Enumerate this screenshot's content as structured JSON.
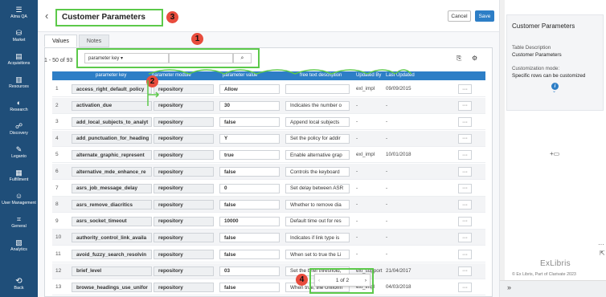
{
  "nav": {
    "items": [
      {
        "label": "Alma QA",
        "icon": "hamburger-icon",
        "glyph": "☰"
      },
      {
        "label": "Market",
        "icon": "market-icon",
        "glyph": "⛁"
      },
      {
        "label": "Acquisitions",
        "icon": "acquisitions-icon",
        "glyph": "▤"
      },
      {
        "label": "Resources",
        "icon": "resources-icon",
        "glyph": "▥"
      },
      {
        "label": "Research",
        "icon": "research-icon",
        "glyph": "◐"
      },
      {
        "label": "Discovery",
        "icon": "discovery-icon",
        "glyph": "☍"
      },
      {
        "label": "Leganto",
        "icon": "leganto-icon",
        "glyph": "✎"
      },
      {
        "label": "Fulfillment",
        "icon": "fulfillment-icon",
        "glyph": "▦"
      },
      {
        "label": "User Management",
        "icon": "user-icon",
        "glyph": "☺"
      },
      {
        "label": "General",
        "icon": "general-icon",
        "glyph": "⌗"
      },
      {
        "label": "Analytics",
        "icon": "analytics-icon",
        "glyph": "▧"
      }
    ],
    "back_label": "Back"
  },
  "header": {
    "title": "Customer Parameters",
    "cancel_label": "Cancel",
    "save_label": "Save"
  },
  "tabs": [
    {
      "label": "Values",
      "active": true
    },
    {
      "label": "Notes",
      "active": false
    }
  ],
  "toolbar": {
    "count": "1 - 50 of 93",
    "filter_field": "parameter key ▾",
    "search_icon": "search-icon"
  },
  "annotations": [
    "1",
    "2",
    "3",
    "4"
  ],
  "table": {
    "headers": [
      "parameter key",
      "parameter module",
      "parameter value",
      "free text description",
      "Updated By",
      "Last Updated"
    ],
    "rows": [
      {
        "num": "1",
        "key": "access_right_default_policy",
        "module": "repository",
        "value": "Allow",
        "desc": "",
        "by": "exl_impl",
        "date": "09/09/2015"
      },
      {
        "num": "2",
        "key": "activation_due",
        "module": "repository",
        "value": "30",
        "desc": "Indicates the number o",
        "by": "-",
        "date": "-"
      },
      {
        "num": "3",
        "key": "add_local_subjects_to_analyt",
        "module": "repository",
        "value": "false",
        "desc": "Append local subjects",
        "by": "-",
        "date": "-"
      },
      {
        "num": "4",
        "key": "add_punctuation_for_heading",
        "module": "repository",
        "value": "Y",
        "desc": "Set the policy for addir",
        "by": "-",
        "date": "-"
      },
      {
        "num": "5",
        "key": "alternate_graphic_represent",
        "module": "repository",
        "value": "true",
        "desc": "Enable alternative grap",
        "by": "exl_impl",
        "date": "10/01/2018"
      },
      {
        "num": "6",
        "key": "alternative_mde_enhance_re",
        "module": "repository",
        "value": "false",
        "desc": "Controls the keyboard",
        "by": "-",
        "date": "-"
      },
      {
        "num": "7",
        "key": "asrs_job_message_delay",
        "module": "repository",
        "value": "0",
        "desc": "Set delay between ASR",
        "by": "-",
        "date": "-"
      },
      {
        "num": "8",
        "key": "asrs_remove_diacritics",
        "module": "repository",
        "value": "false",
        "desc": "Whether to remove dia",
        "by": "-",
        "date": "-"
      },
      {
        "num": "9",
        "key": "asrs_socket_timeout",
        "module": "repository",
        "value": "10000",
        "desc": "Default time out for res",
        "by": "-",
        "date": "-"
      },
      {
        "num": "10",
        "key": "authority_control_link_availa",
        "module": "repository",
        "value": "false",
        "desc": "Indicates if link type is",
        "by": "-",
        "date": "-"
      },
      {
        "num": "11",
        "key": "avoid_fuzzy_search_resolvin",
        "module": "repository",
        "value": "false",
        "desc": "When set to true the Li",
        "by": "-",
        "date": "-"
      },
      {
        "num": "12",
        "key": "brief_level",
        "module": "repository",
        "value": "03",
        "desc": "Set the brief threshold,",
        "by": "exl_support",
        "date": "21/04/2017"
      },
      {
        "num": "13",
        "key": "browse_headings_use_unifor",
        "module": "repository",
        "value": "false",
        "desc": "When true, the Uniform",
        "by": "exl_impl",
        "date": "04/03/2018"
      }
    ],
    "more_glyph": "···"
  },
  "pager": {
    "prev": "‹",
    "label": "1 of 2",
    "next": "›"
  },
  "right_panel": {
    "title": "Customer Parameters",
    "desc_label": "Table Description",
    "desc_value": "Customer Parameters",
    "mode_label": "Customization mode:",
    "mode_value": "Specific rows can be customized",
    "info_glyph": "i",
    "logo": "ExLibris",
    "copyright": "© Ex Libris, Part of Clarivate  2023",
    "expand_glyph": "»",
    "more_glyph": "···",
    "add_glyph": "+▭",
    "collapse_glyph": "⇱"
  },
  "colors": {
    "nav_bg": "#1f4e79",
    "accent": "#2d7ec6",
    "highlight": "#5cc94a",
    "badge": "#e84c3d"
  }
}
